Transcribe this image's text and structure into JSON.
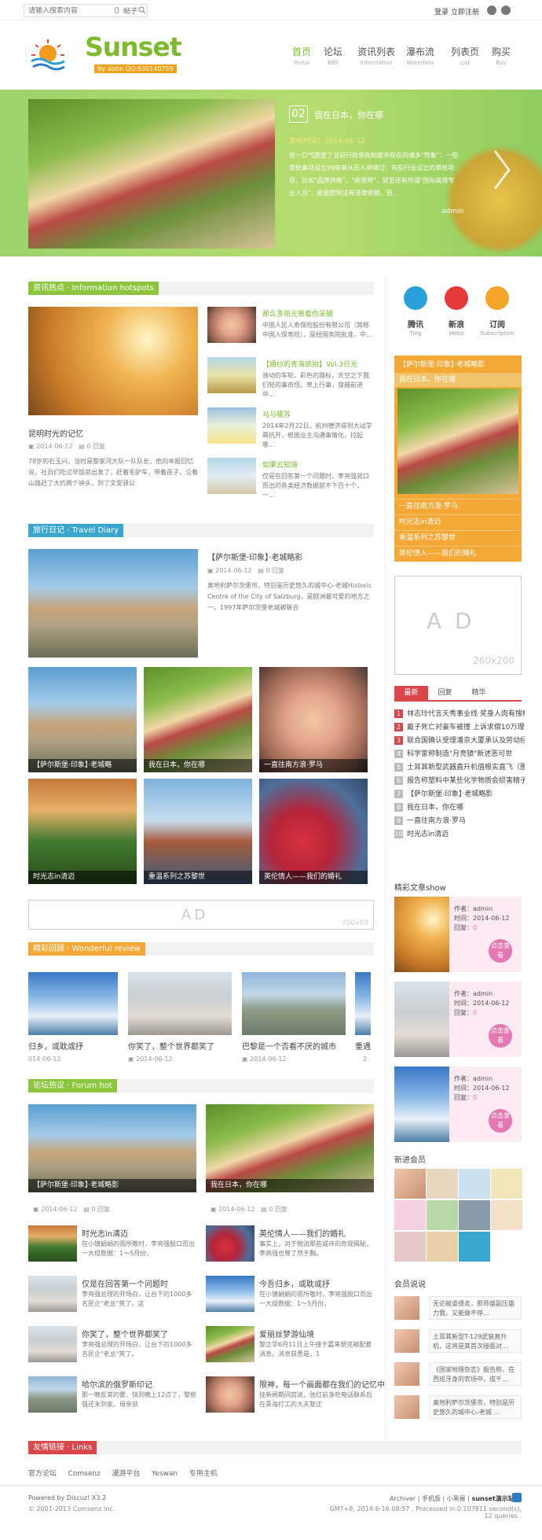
{
  "topbar": {
    "search_placeholder": "请输入搜索内容",
    "hot_label": "帖子",
    "login": "登录",
    "register": "立即注册"
  },
  "logo": {
    "name": "Sunset",
    "by": "By dotin QQ:930140759"
  },
  "nav": [
    {
      "zh": "首页",
      "en": "Portal"
    },
    {
      "zh": "论坛",
      "en": "BBS"
    },
    {
      "zh": "资讯列表",
      "en": "Information"
    },
    {
      "zh": "瀑布流",
      "en": "Waterfalls"
    },
    {
      "zh": "列表页",
      "en": "List"
    },
    {
      "zh": "购买",
      "en": "Buy"
    }
  ],
  "banner": {
    "num": "02",
    "title": "我在日本，你在哪",
    "date": "发帖时间：2014-06-12",
    "text": "自一口气跑里了当前行政单政制度中存在的诸多\"怪象\"：一些审批事项设立99年来从无人申请过；有些行业设立的审核项目，比如\"品牌资格\"，\"商誉师\"，就至还有所谓\"国际高效专业人员\"，能装腔到没有法律依据，但...",
    "author": "admin"
  },
  "hotspots": {
    "tag": "资讯热点 · Information hotspots",
    "main": {
      "title": "昆明时光的记忆",
      "date": "2014-06-12",
      "reply": "0 回复",
      "summary": "78岁的石玉兴，当时是黎家河大队一队队长，他向本报回忆说，社员们吃过早饭就出发了，赶着毛驴车，带着孩子，沿着山路赶了大约两个钟头，到了文安驿公"
    },
    "items": [
      {
        "title": "那么多阳光等着你采摘",
        "summary": "中国人民人寿保险股份有限公司（简称中国人保寿险），是经国务院批准，中..."
      },
      {
        "title": "【婚纱的青海旅拍】Vol.3日光",
        "summary": "骑动的车轮，彩色的路标，天空之下我们轻的事奇怪。草上行事，穿越前进中..."
      },
      {
        "title": "马与暖苏",
        "summary": "2014年2月22日，杭州德济得到大战学幕抗开，根据业主沟通事情化，拉起哪..."
      },
      {
        "title": "如果云知道",
        "summary": "仅是在回答第一个问题时，李亮强就口而出的各类经济数据就不下百十个，一..."
      }
    ]
  },
  "travel": {
    "tag": "旅行日记 · Travel Diary",
    "feature": {
      "title": "【萨尔斯堡·印象】·老城略影",
      "date": "2014-06-12",
      "reply": "0 回复",
      "summary": "奥地利萨尔茨堡市，特别是历史悠久的城中心-老城Historic Centre of the City of Salzburg，是欧洲最可爱的地方之一。1997年萨尔茨堡老城被联合"
    },
    "grid": [
      "【萨尔斯堡·印象】·老城略",
      "我在日本，你在哪",
      "一直往南方浪·罗马",
      "时光志in清迈",
      "重温系列之苏黎世",
      "英伦情人——我们的婚礼"
    ]
  },
  "ad_main": {
    "text": "AD",
    "size": "700x60"
  },
  "review": {
    "tag": "精彩回顾 · Wonderful review",
    "items": [
      {
        "title": "归乡，或耽或抒",
        "date": "014-06-12"
      },
      {
        "title": "你笑了，整个世界都笑了",
        "date": "2014-06-12"
      },
      {
        "title": "巴黎是一个否看不厌的城市",
        "date": "2014-06-12"
      },
      {
        "title": "重遇",
        "date": "2"
      }
    ]
  },
  "forum": {
    "tag": "论坛热议 · Forum hot",
    "big": [
      {
        "title": "【萨尔斯堡·印象】·老城略影",
        "date": "2014-06-12",
        "reply": "0 回复"
      },
      {
        "title": "我在日本，你在哪",
        "date": "2014-06-12",
        "reply": "0 回复"
      }
    ],
    "items": [
      {
        "title": "时光志in清迈",
        "summary": "在小镇娟娟的雨所敬时，李亮强脱口而出一大组数据：1～5月份，"
      },
      {
        "title": "英伦情人——我们的婚礼",
        "summary": "事实上，对于物流那些或许的奇观揭秘，李亮强也曾了然于胸。"
      },
      {
        "title": "仅是在回答第一个问题时",
        "summary": "李亮强总理的开场白，让台下的1000多名民企\"老总\"笑了。这"
      },
      {
        "title": "今吾归乡，或耽或抒",
        "summary": "在小镇娟娟的雨所敬时，李亮强脱口而出一大组数据：1～5月份，"
      },
      {
        "title": "你笑了，整个世界都笑了",
        "summary": "李亮强总理的开场白，让台下的1000多名民企\"老总\"笑了。"
      },
      {
        "title": "爱丽丝梦游仙境",
        "summary": "黎正学6月11日上午接于嘉来塑克被配套消息。消息获悉是，1"
      },
      {
        "title": "哈尔滨的俄罗斯印记",
        "summary": "那一晚反常的雾，快到晚上12点了，黎依强还未到家。母亲就"
      },
      {
        "title": "限神，每一个画面都在我们的记忆中",
        "summary": "挂新闻期间宫说，张红前身吃电话联系后在青海打工的大夫黎正"
      }
    ]
  },
  "links": {
    "tag": "友情链接 · Links",
    "items": [
      "官方论坛",
      "Comsenz",
      "漫游平台",
      "Yeswan",
      "专用主机"
    ]
  },
  "sidebar": {
    "social": [
      {
        "zh": "腾讯",
        "en": "Ting",
        "color": "#2aa1d8"
      },
      {
        "zh": "新浪",
        "en": "Webo",
        "color": "#e43a3a"
      },
      {
        "zh": "订阅",
        "en": "Subscription",
        "color": "#f4a428"
      }
    ],
    "orange_list": {
      "top": "【萨尔斯堡·印象】·老城略影",
      "selected": "我在日本，你在哪",
      "items": [
        "一直往南方浪·罗马",
        "时光志in清迈",
        "重温系列之苏黎世",
        "英伦情人——我们的婚礼"
      ]
    },
    "ad": {
      "text": "A D",
      "size": "260x200"
    },
    "tabs": [
      "最新",
      "回复",
      "精华"
    ],
    "latest": [
      "林志玲代言天秀事业线 奖身人肉有搜板",
      "戴子死亡对豪车被撞 上诉求偿10万理损失",
      "联合国确认受理潘京大厦承认及劳动经确提交",
      "科学家称制造\"月亮镜\"新述恶可世",
      "土耳其新型武器直升机值根实直飞（图）",
      "报告称塑料中某些化学物质会损害精子DNA",
      "【萨尔斯堡·印象】·老城略影",
      "我在日本，你在哪",
      "一直往南方浪·罗马",
      "时光志in清迈"
    ],
    "show_title": "精彩文章show",
    "show_items": [
      {
        "author": "作者：admin",
        "time": "时间：2014-06-12",
        "reply": "回复：",
        "count": "0",
        "btn": "点击查看"
      },
      {
        "author": "作者：admin",
        "time": "时间：2014-06-12",
        "reply": "回复：",
        "count": "0",
        "btn": "点击查看"
      },
      {
        "author": "作者：admin",
        "time": "时间：2014-06-12",
        "reply": "回复：",
        "count": "0",
        "btn": "点击查看"
      }
    ],
    "members_title": "新进会员",
    "talk_title": "会员说说",
    "talks": [
      "无论被虐侵走，那师盛副压盛力我，又能做不停...",
      "土耳其新型T-129武装直升机，这将是其首次接面对...",
      "《国家地理杂志》报告称，在西班牙身的农场中，成千...",
      "奥地利萨尔茨堡市，特别是历史悠久的城中心-老城 ..."
    ]
  },
  "footer": {
    "powered": "Powered by Discuz! X3.2",
    "copyright": "© 2001-2013 Comsenz Inc.",
    "links": [
      "Archiver",
      "手机版",
      "小黑屋",
      "sunset演示站"
    ],
    "time": "GMT+8, 2014-6-16 08:57 , Processed in 0.107811 second(s), 12 queries ."
  }
}
